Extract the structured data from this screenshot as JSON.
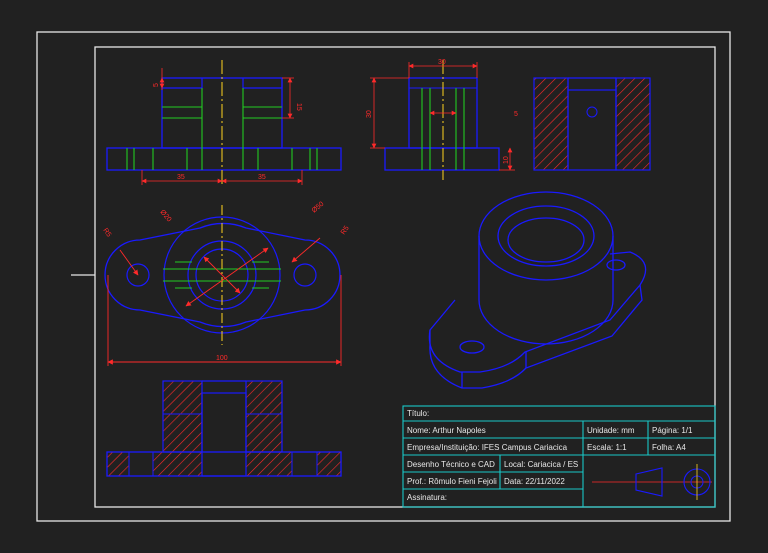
{
  "dimensions": {
    "top_front": {
      "d5": "5",
      "d15": "15",
      "d35_left": "35",
      "d35_right": "35"
    },
    "top_side": {
      "d30_top": "30",
      "d30_left": "30",
      "d5": "5",
      "d10": "10"
    },
    "plan": {
      "r5_left": "R5",
      "d20": "Ø20",
      "d50": "Ø50",
      "r5_right": "R5",
      "d100": "100"
    }
  },
  "title_block": {
    "titulo": "Título:",
    "nome": "Nome: Arthur Napoles",
    "unidade": "Unidade: mm",
    "pagina": "Página: 1/1",
    "empresa": "Empresa/Instituição: IFES Campus Cariacica",
    "escala": "Escala: 1:1",
    "folha": "Folha: A4",
    "disciplina": "Desenho Técnico e CAD",
    "local": "Local: Cariacica / ES",
    "professor": "Prof.: Rômulo Fieni Fejoli",
    "data": "Data: 22/11/2022",
    "assinatura": "Assinatura:"
  },
  "colors": {
    "background": "#212121",
    "frame": "#e6e6e6",
    "outline": "#1a1aff",
    "hidden": "#22cc22",
    "dimension": "#ff2a2a",
    "center": "#ffd21f",
    "title_block": "#19c8c8"
  }
}
